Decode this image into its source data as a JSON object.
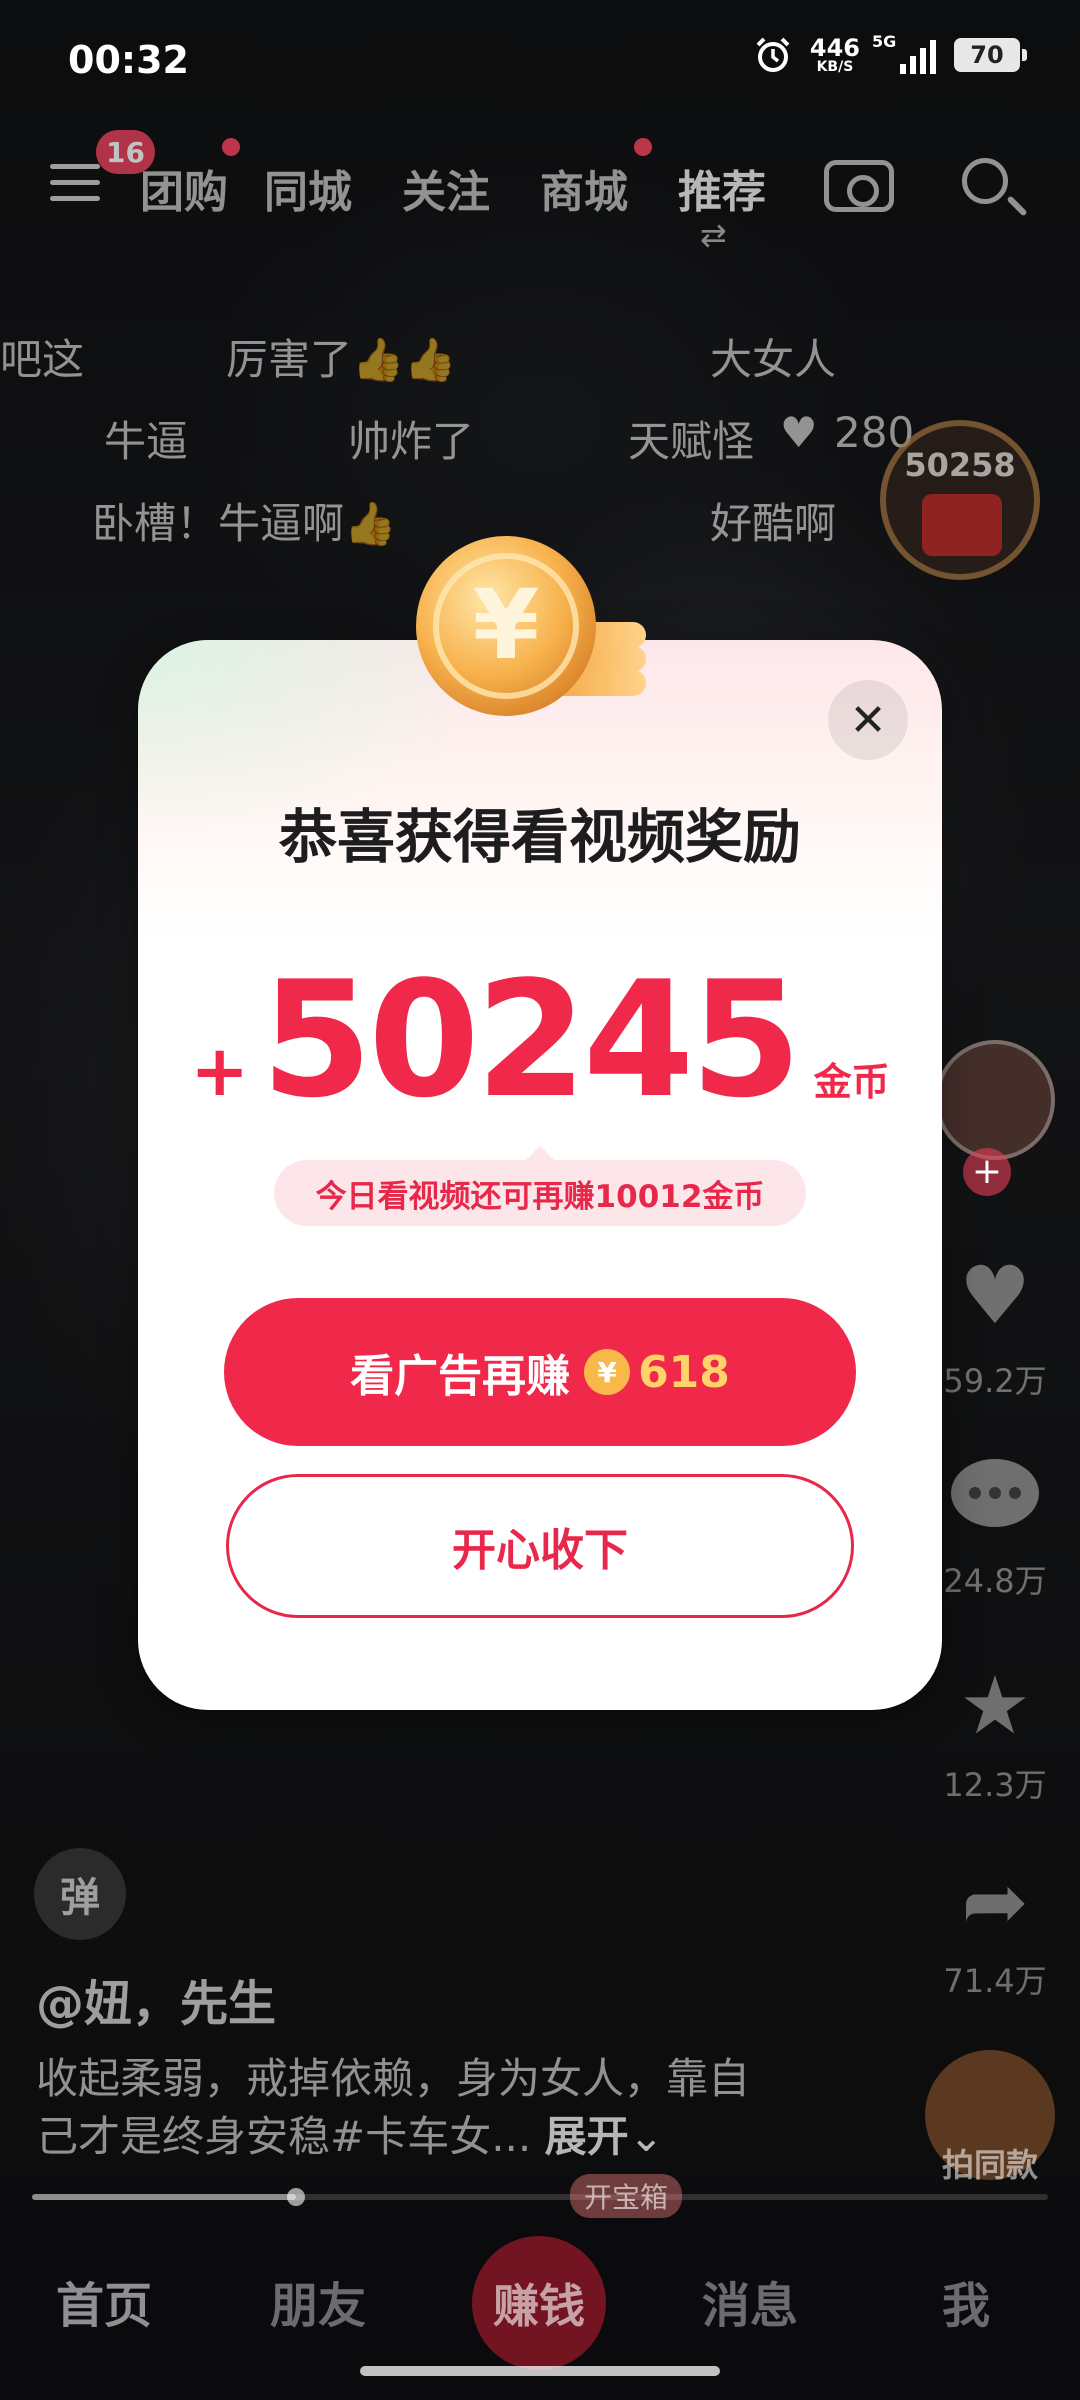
{
  "status_bar": {
    "time": "00:32",
    "net_speed_value": "446",
    "net_speed_unit": "KB/S",
    "signal_label": "5G",
    "battery": "70"
  },
  "top_nav": {
    "badge_count": "16",
    "tabs": [
      "团购",
      "同城",
      "关注",
      "商城",
      "推荐"
    ]
  },
  "danmaku": [
    "吧这",
    "厉害了👍👍",
    "大女人",
    "牛逼",
    "帅炸了",
    "天赋怪",
    "卧槽！牛逼啊👍",
    "好酷啊"
  ],
  "danmaku_likes": "280",
  "right_rail": {
    "reward_coins": "50258",
    "likes": "59.2万",
    "comments": "24.8万",
    "favorites": "12.3万",
    "shares": "71.4万",
    "same_style_label": "拍同款"
  },
  "video": {
    "danmaku_toggle": "弹",
    "author": "@妞，先生",
    "caption": "收起柔弱，戒掉依赖，身为女人，靠自己才是终身安稳#卡车女...",
    "expand": "展开",
    "progress_fraction": 0.26
  },
  "modal": {
    "title": "恭喜获得看视频奖励",
    "amount_sign": "+",
    "amount": "50245",
    "amount_unit": "金币",
    "tip": "今日看视频还可再赚10012金币",
    "primary_label": "看广告再赚",
    "coin_symbol": "¥",
    "primary_bonus": "618",
    "secondary_label": "开心收下",
    "close_symbol": "✕"
  },
  "tab_bar": {
    "tabs": [
      "首页",
      "朋友",
      "赚钱",
      "消息",
      "我"
    ],
    "treasure_tag": "开宝箱"
  },
  "colors": {
    "accent": "#f0284a",
    "tip_bg": "#fde6ea",
    "coin_gold": "#f8b84a"
  }
}
